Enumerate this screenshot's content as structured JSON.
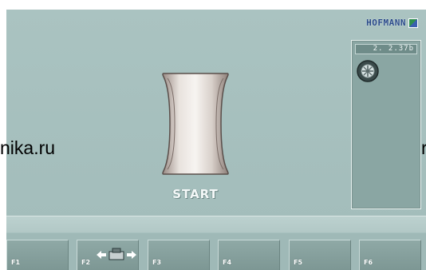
{
  "brand": {
    "name": "HOFMANN",
    "logo_icon": "hofmann-flag-icon"
  },
  "side_panel": {
    "readout": "2. 2.37b",
    "wheel_icon": "wheel-icon"
  },
  "main": {
    "rim_icon": "rim-profile-icon",
    "start_label": "START"
  },
  "function_keys": [
    {
      "label": "F1",
      "icon": null
    },
    {
      "label": "F2",
      "icon": "clamp-arrows-icon"
    },
    {
      "label": "F3",
      "icon": null
    },
    {
      "label": "F4",
      "icon": null
    },
    {
      "label": "F5",
      "icon": null
    },
    {
      "label": "F6",
      "icon": null
    }
  ],
  "overlays": {
    "left_watermark": "nika.ru",
    "right_fragment": "r"
  },
  "colors": {
    "screen_bg": "#a7c0be",
    "panel_bg": "#8aa6a3",
    "key_bg": "#8fa9a6",
    "brand_blue": "#2a4a8a"
  }
}
